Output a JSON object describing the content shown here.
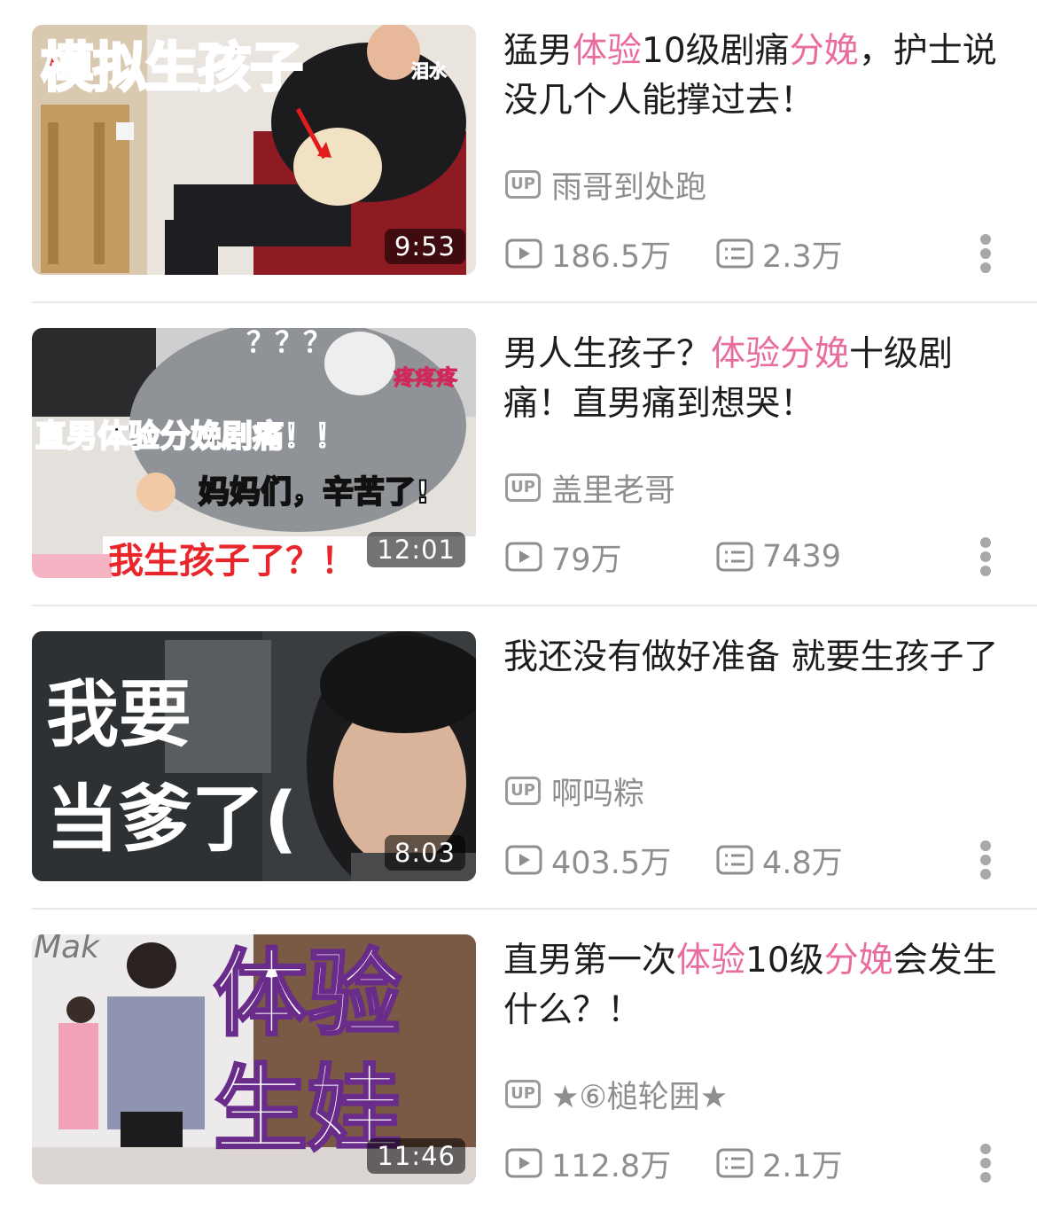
{
  "videos": [
    {
      "title_parts": [
        {
          "text": "猛男"
        },
        {
          "text": "体验",
          "highlight": true
        },
        {
          "text": "10级剧痛"
        },
        {
          "text": "分娩",
          "highlight": true
        },
        {
          "text": "，护士说没几个人能撑过去！"
        }
      ],
      "duration": "9:53",
      "uploader": "雨哥到处跑",
      "plays": "186.5万",
      "danmaku": "2.3万",
      "thumb_text": [
        "模拟生孩子",
        "泪水"
      ]
    },
    {
      "title_parts": [
        {
          "text": "男人生孩子？"
        },
        {
          "text": "体验分娩",
          "highlight": true
        },
        {
          "text": "十级剧痛！直男痛到想哭！"
        }
      ],
      "duration": "12:01",
      "uploader": "盖里老哥",
      "plays": "79万",
      "danmaku": "7439",
      "thumb_text": [
        "？？？",
        "疼疼疼",
        "直男体验分娩剧痛！！",
        "妈妈们，辛苦了!",
        "我生孩子了？！"
      ]
    },
    {
      "title_parts": [
        {
          "text": "我还没有做好准备 就要生孩子了"
        }
      ],
      "duration": "8:03",
      "uploader": "啊吗粽",
      "plays": "403.5万",
      "danmaku": "4.8万",
      "thumb_text": [
        "我要",
        "当爹了("
      ]
    },
    {
      "title_parts": [
        {
          "text": "直男第一次"
        },
        {
          "text": "体验",
          "highlight": true
        },
        {
          "text": "10级"
        },
        {
          "text": "分娩",
          "highlight": true
        },
        {
          "text": "会发生什么？！"
        }
      ],
      "duration": "11:46",
      "uploader": "★⑥槌轮囲★",
      "plays": "112.8万",
      "danmaku": "2.1万",
      "thumb_text": [
        "Mak",
        "体验",
        "生娃"
      ]
    }
  ],
  "labels": {
    "up_badge": "UP"
  },
  "icons": {
    "play": "play-count-icon",
    "danmaku": "danmaku-count-icon",
    "more": "more-vertical-icon"
  },
  "colors": {
    "highlight": "#e86c9e",
    "meta": "#8e8e8e",
    "divider": "#e7e7e7"
  }
}
